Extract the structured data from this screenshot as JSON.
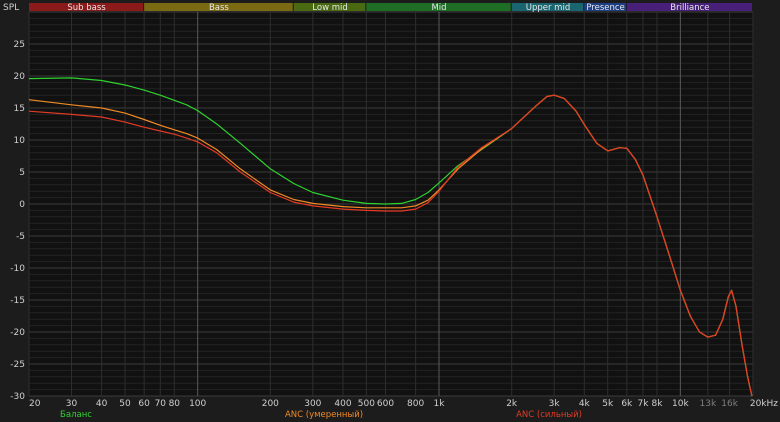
{
  "chart_data": {
    "type": "line",
    "ylabel": "SPL",
    "xunit": "kHz",
    "x_scale": "log",
    "xlim": [
      20,
      20000
    ],
    "ylim": [
      -30,
      30
    ],
    "grid": true,
    "legend_placement": "bottom",
    "y_ticks": [
      25,
      20,
      15,
      10,
      5,
      0,
      -5,
      -10,
      -15,
      -20,
      -25,
      -30
    ],
    "x_ticks": [
      {
        "value": 20,
        "label": "20"
      },
      {
        "value": 30,
        "label": "30"
      },
      {
        "value": 40,
        "label": "40"
      },
      {
        "value": 50,
        "label": "50"
      },
      {
        "value": 60,
        "label": "60"
      },
      {
        "value": 70,
        "label": "70"
      },
      {
        "value": 80,
        "label": "80"
      },
      {
        "value": 100,
        "label": "100"
      },
      {
        "value": 200,
        "label": "200"
      },
      {
        "value": 300,
        "label": "300"
      },
      {
        "value": 400,
        "label": "400"
      },
      {
        "value": 500,
        "label": "500"
      },
      {
        "value": 600,
        "label": "600"
      },
      {
        "value": 800,
        "label": "800"
      },
      {
        "value": 1000,
        "label": "1k"
      },
      {
        "value": 2000,
        "label": "2k"
      },
      {
        "value": 3000,
        "label": "3k"
      },
      {
        "value": 4000,
        "label": "4k"
      },
      {
        "value": 5000,
        "label": "5k"
      },
      {
        "value": 6000,
        "label": "6k"
      },
      {
        "value": 7000,
        "label": "7k"
      },
      {
        "value": 8000,
        "label": "8k"
      },
      {
        "value": 10000,
        "label": "10k"
      },
      {
        "value": 13000,
        "label": "13k",
        "dim": true
      },
      {
        "value": 16000,
        "label": "16k",
        "dim": true
      },
      {
        "value": 20000,
        "label": "20kHz"
      }
    ],
    "bands": [
      {
        "label": "Sub bass",
        "from": 20,
        "to": 60,
        "color": "#8b1a1a"
      },
      {
        "label": "Bass",
        "from": 60,
        "to": 250,
        "color": "#7a6a12"
      },
      {
        "label": "Low mid",
        "from": 250,
        "to": 500,
        "color": "#4a6a12"
      },
      {
        "label": "Mid",
        "from": 500,
        "to": 2000,
        "color": "#1f6e25"
      },
      {
        "label": "Upper mid",
        "from": 2000,
        "to": 4000,
        "color": "#1a6670"
      },
      {
        "label": "Presence",
        "from": 4000,
        "to": 6000,
        "color": "#1f3f85"
      },
      {
        "label": "Brilliance",
        "from": 6000,
        "to": 20000,
        "color": "#48207a"
      }
    ],
    "series": [
      {
        "name": "Баланс",
        "color": "#2fd12f",
        "points": [
          [
            20,
            19.6
          ],
          [
            30,
            19.7
          ],
          [
            40,
            19.3
          ],
          [
            50,
            18.6
          ],
          [
            60,
            17.8
          ],
          [
            70,
            17.0
          ],
          [
            80,
            16.2
          ],
          [
            90,
            15.5
          ],
          [
            100,
            14.6
          ],
          [
            120,
            12.5
          ],
          [
            150,
            9.5
          ],
          [
            200,
            5.5
          ],
          [
            250,
            3.2
          ],
          [
            300,
            1.8
          ],
          [
            400,
            0.6
          ],
          [
            500,
            0.1
          ],
          [
            600,
            0.0
          ],
          [
            700,
            0.1
          ],
          [
            800,
            0.7
          ],
          [
            900,
            1.8
          ],
          [
            1000,
            3.3
          ],
          [
            1200,
            6.0
          ],
          [
            1500,
            8.5
          ],
          [
            2000,
            11.8
          ],
          [
            2500,
            15.2
          ],
          [
            2800,
            16.8
          ],
          [
            3000,
            17.0
          ],
          [
            3300,
            16.5
          ],
          [
            3700,
            14.5
          ],
          [
            4000,
            12.4
          ],
          [
            4500,
            9.5
          ],
          [
            5000,
            8.3
          ],
          [
            5600,
            8.8
          ],
          [
            6000,
            8.7
          ],
          [
            6500,
            7.0
          ],
          [
            7000,
            4.5
          ],
          [
            8000,
            -2.0
          ],
          [
            9000,
            -8.0
          ],
          [
            10000,
            -13.5
          ],
          [
            11000,
            -17.5
          ],
          [
            12000,
            -20.0
          ],
          [
            13000,
            -20.8
          ],
          [
            14000,
            -20.5
          ],
          [
            15000,
            -18.0
          ],
          [
            15800,
            -14.5
          ],
          [
            16300,
            -13.5
          ],
          [
            17000,
            -16.0
          ],
          [
            18000,
            -22.0
          ],
          [
            19000,
            -27.0
          ],
          [
            19800,
            -30.0
          ]
        ]
      },
      {
        "name": "ANC (умеренный)",
        "color": "#f08a24",
        "points": [
          [
            20,
            16.3
          ],
          [
            30,
            15.5
          ],
          [
            40,
            15.0
          ],
          [
            50,
            14.2
          ],
          [
            60,
            13.2
          ],
          [
            70,
            12.3
          ],
          [
            80,
            11.6
          ],
          [
            90,
            11.0
          ],
          [
            100,
            10.3
          ],
          [
            120,
            8.5
          ],
          [
            150,
            5.5
          ],
          [
            200,
            2.2
          ],
          [
            250,
            0.7
          ],
          [
            300,
            0.1
          ],
          [
            400,
            -0.4
          ],
          [
            500,
            -0.6
          ],
          [
            600,
            -0.6
          ],
          [
            700,
            -0.6
          ],
          [
            800,
            -0.3
          ],
          [
            900,
            0.6
          ],
          [
            1000,
            2.2
          ],
          [
            1200,
            5.5
          ],
          [
            1500,
            8.6
          ],
          [
            2000,
            11.8
          ],
          [
            2500,
            15.2
          ],
          [
            2800,
            16.8
          ],
          [
            3000,
            17.0
          ],
          [
            3300,
            16.5
          ],
          [
            3700,
            14.5
          ],
          [
            4000,
            12.4
          ],
          [
            4500,
            9.5
          ],
          [
            5000,
            8.3
          ],
          [
            5600,
            8.8
          ],
          [
            6000,
            8.7
          ],
          [
            6500,
            7.0
          ],
          [
            7000,
            4.5
          ],
          [
            8000,
            -2.0
          ],
          [
            9000,
            -8.0
          ],
          [
            10000,
            -13.5
          ],
          [
            11000,
            -17.5
          ],
          [
            12000,
            -20.0
          ],
          [
            13000,
            -20.8
          ],
          [
            14000,
            -20.5
          ],
          [
            15000,
            -18.0
          ],
          [
            15800,
            -14.5
          ],
          [
            16300,
            -13.5
          ],
          [
            17000,
            -16.0
          ],
          [
            18000,
            -22.0
          ],
          [
            19000,
            -27.0
          ],
          [
            19800,
            -30.0
          ]
        ]
      },
      {
        "name": "ANC (сильный)",
        "color": "#e23a24",
        "points": [
          [
            20,
            14.5
          ],
          [
            30,
            14.0
          ],
          [
            40,
            13.6
          ],
          [
            50,
            12.8
          ],
          [
            60,
            12.0
          ],
          [
            70,
            11.4
          ],
          [
            80,
            10.9
          ],
          [
            90,
            10.3
          ],
          [
            100,
            9.7
          ],
          [
            120,
            8.0
          ],
          [
            150,
            5.0
          ],
          [
            200,
            1.8
          ],
          [
            250,
            0.3
          ],
          [
            300,
            -0.3
          ],
          [
            400,
            -0.8
          ],
          [
            500,
            -1.0
          ],
          [
            600,
            -1.1
          ],
          [
            700,
            -1.1
          ],
          [
            800,
            -0.8
          ],
          [
            900,
            0.2
          ],
          [
            1000,
            2.0
          ],
          [
            1200,
            5.8
          ],
          [
            1500,
            8.8
          ],
          [
            2000,
            11.8
          ],
          [
            2500,
            15.2
          ],
          [
            2800,
            16.8
          ],
          [
            3000,
            17.0
          ],
          [
            3300,
            16.5
          ],
          [
            3700,
            14.5
          ],
          [
            4000,
            12.4
          ],
          [
            4500,
            9.5
          ],
          [
            5000,
            8.3
          ],
          [
            5600,
            8.8
          ],
          [
            6000,
            8.7
          ],
          [
            6500,
            7.0
          ],
          [
            7000,
            4.5
          ],
          [
            8000,
            -2.0
          ],
          [
            9000,
            -8.0
          ],
          [
            10000,
            -13.5
          ],
          [
            11000,
            -17.5
          ],
          [
            12000,
            -20.0
          ],
          [
            13000,
            -20.8
          ],
          [
            14000,
            -20.5
          ],
          [
            15000,
            -18.0
          ],
          [
            15800,
            -14.5
          ],
          [
            16300,
            -13.5
          ],
          [
            17000,
            -16.0
          ],
          [
            18000,
            -22.0
          ],
          [
            19000,
            -27.0
          ],
          [
            19800,
            -30.0
          ]
        ]
      }
    ]
  }
}
